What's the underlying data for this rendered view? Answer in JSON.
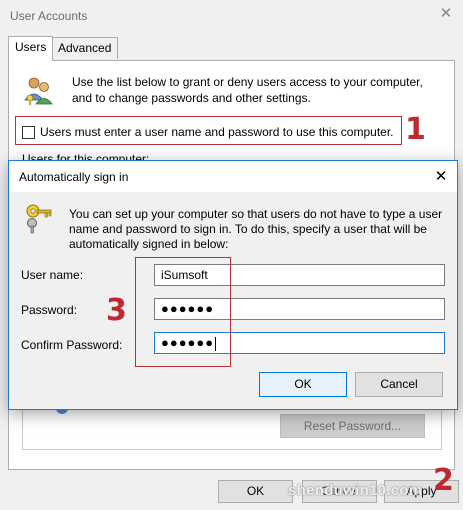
{
  "window": {
    "title": "User Accounts",
    "close_glyph": "✕"
  },
  "tabs": [
    {
      "label": "Users",
      "active": true
    },
    {
      "label": "Advanced",
      "active": false
    }
  ],
  "users_tab": {
    "intro": "Use the list below to grant or deny users access to your computer, and to change passwords and other settings.",
    "must_enter_label": "Users must enter a user name and password to use this computer.",
    "must_enter_checked": false,
    "users_for_computer_label": "Users for this computer:",
    "reset_password_label": "Reset Password..."
  },
  "footer": {
    "ok_label": "OK",
    "cancel_label": "Cancel",
    "apply_label": "Apply"
  },
  "dialog": {
    "title": "Automatically sign in",
    "close_glyph": "✕",
    "description": "You can set up your computer so that users do not have to type a user name and password to sign in. To do this, specify a user that will be automatically signed in below:",
    "user_name_label": "User name:",
    "user_name_value": "iSumsoft",
    "password_label": "Password:",
    "password_value": "●●●●●●",
    "confirm_label": "Confirm Password:",
    "confirm_value": "●●●●●●",
    "ok_label": "OK",
    "cancel_label": "Cancel"
  },
  "annotations": {
    "step1": "1",
    "step2": "2",
    "step3": "3",
    "color": "#c0282f"
  },
  "watermark": "shenduwin10.com"
}
